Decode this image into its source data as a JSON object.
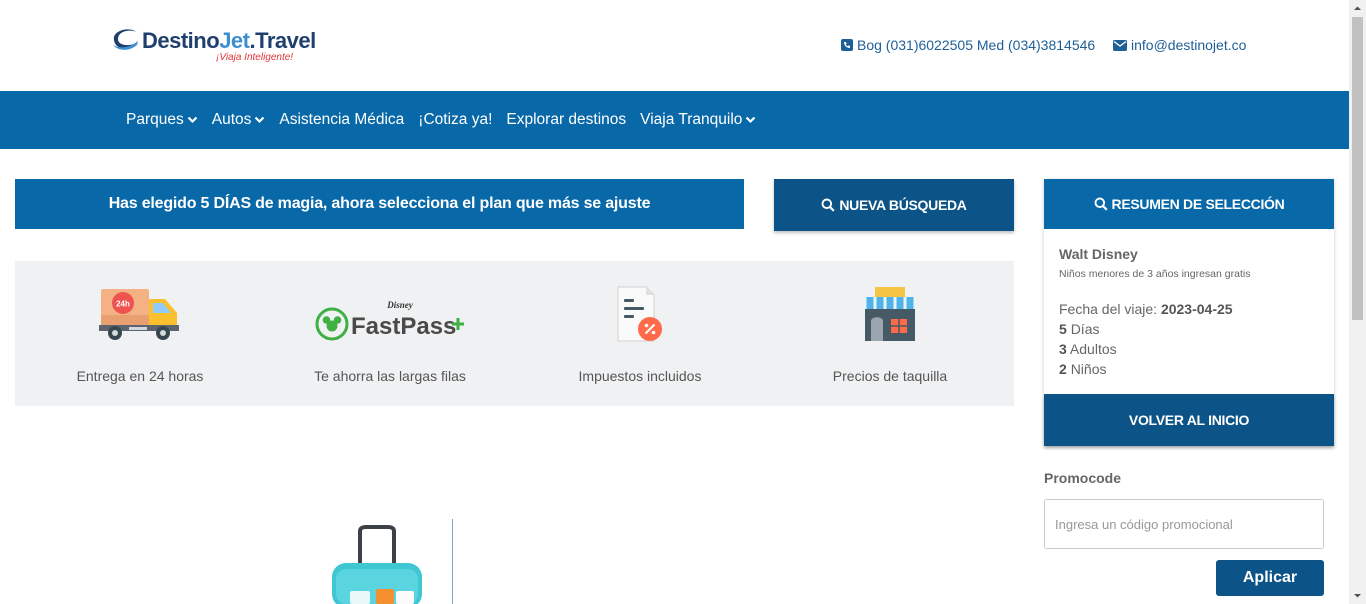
{
  "header": {
    "logo": {
      "part1": "Destino",
      "part2": "Jet",
      "part3": ".Travel",
      "tagline": "¡Viaja Inteligente!"
    },
    "phone": "Bog (031)6022505 Med (034)3814546",
    "email": "info@destinojet.co"
  },
  "nav": {
    "items": [
      {
        "label": "Parques",
        "dropdown": true
      },
      {
        "label": "Autos",
        "dropdown": true
      },
      {
        "label": "Asistencia Médica",
        "dropdown": false
      },
      {
        "label": "¡Cotiza ya!",
        "dropdown": false
      },
      {
        "label": "Explorar destinos",
        "dropdown": false
      },
      {
        "label": "Viaja Tranquilo",
        "dropdown": true
      }
    ]
  },
  "main": {
    "banner": "Has elegido 5 DÍAS de magia, ahora selecciona el plan que más se ajuste",
    "new_search_label": "NUEVA BÚSQUEDA",
    "features": [
      {
        "icon": "delivery-truck-icon",
        "label": "Entrega en 24 horas",
        "badge": "24h"
      },
      {
        "icon": "fastpass-logo",
        "label": "Te ahorra las largas filas",
        "brand": "Disney",
        "logo_text": "FastPass"
      },
      {
        "icon": "tax-document-icon",
        "label": "Impuestos incluidos"
      },
      {
        "icon": "ticket-booth-icon",
        "label": "Precios de taquilla"
      }
    ]
  },
  "summary": {
    "title": "RESUMEN DE SELECCIÓN",
    "park": "Walt Disney",
    "note": "Niños menores de 3 años ingresan gratis",
    "date_label": "Fecha del viaje:",
    "date_value": "2023-04-25",
    "days_value": "5",
    "days_label": "Días",
    "adults_value": "3",
    "adults_label": "Adultos",
    "kids_value": "2",
    "kids_label": "Niños",
    "back_label": "VOLVER AL INICIO"
  },
  "promo": {
    "label": "Promocode",
    "placeholder": "Ingresa un código promocional",
    "value": "",
    "apply_label": "Aplicar"
  },
  "colors": {
    "primary": "#0868a8",
    "dark_button": "#0c5488",
    "feature_bg": "#f0f1f2",
    "tagline": "#e0343b",
    "fastpass_green": "#3fb044"
  }
}
